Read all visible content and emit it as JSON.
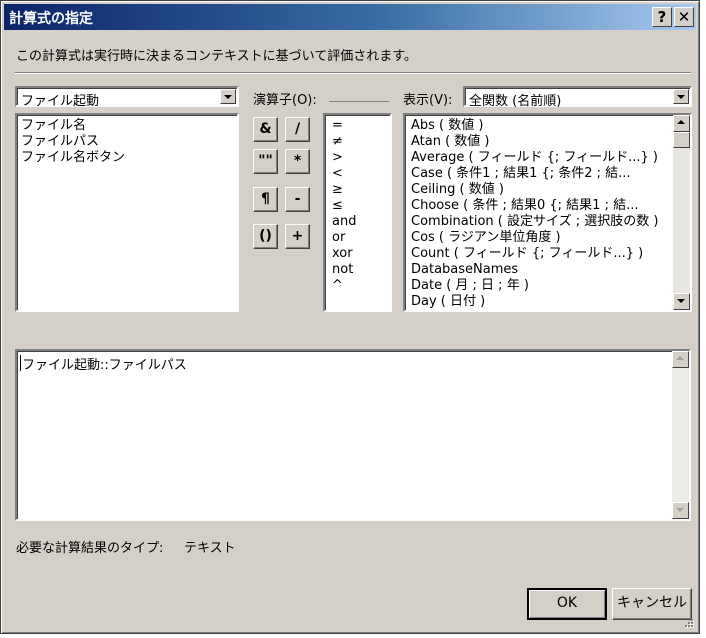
{
  "window": {
    "title": "計算式の指定",
    "help_label": "?",
    "close_label": "✕"
  },
  "description": "この計算式は実行時に決まるコンテキストに基づいて評価されます。",
  "table_combo": {
    "value": "ファイル起動"
  },
  "fields": [
    "ファイル名",
    "ファイルパス",
    "ファイル名ボタン"
  ],
  "operators": {
    "label": "演算子(O):",
    "buttons": [
      "&",
      "/",
      "\"\"",
      "*",
      "¶",
      "-",
      "()",
      "+"
    ],
    "list": [
      "=",
      "≠",
      ">",
      "<",
      "≥",
      "≤",
      "and",
      "or",
      "xor",
      "not",
      "^"
    ]
  },
  "view": {
    "label": "表示(V):",
    "value": "全関数 (名前順)"
  },
  "functions": [
    "Abs ( 数値 )",
    "Atan ( 数値 )",
    "Average ( フィールド {; フィールド...} )",
    "Case ( 条件1 ; 結果1 {; 条件2 ; 結...",
    "Ceiling ( 数値 )",
    "Choose ( 条件 ; 結果0 {; 結果1 ; 結...",
    "Combination ( 設定サイズ ; 選択肢の数 )",
    "Cos ( ラジアン単位角度 )",
    "Count ( フィールド {; フィールド...} )",
    "DatabaseNames",
    "Date ( 月 ; 日 ; 年 )",
    "Day ( 日付 )"
  ],
  "formula": "ファイル起動::ファイルパス",
  "result_type": {
    "label": "必要な計算結果のタイプ:",
    "value": "テキスト"
  },
  "buttons": {
    "ok": "OK",
    "cancel": "キャンセル"
  }
}
